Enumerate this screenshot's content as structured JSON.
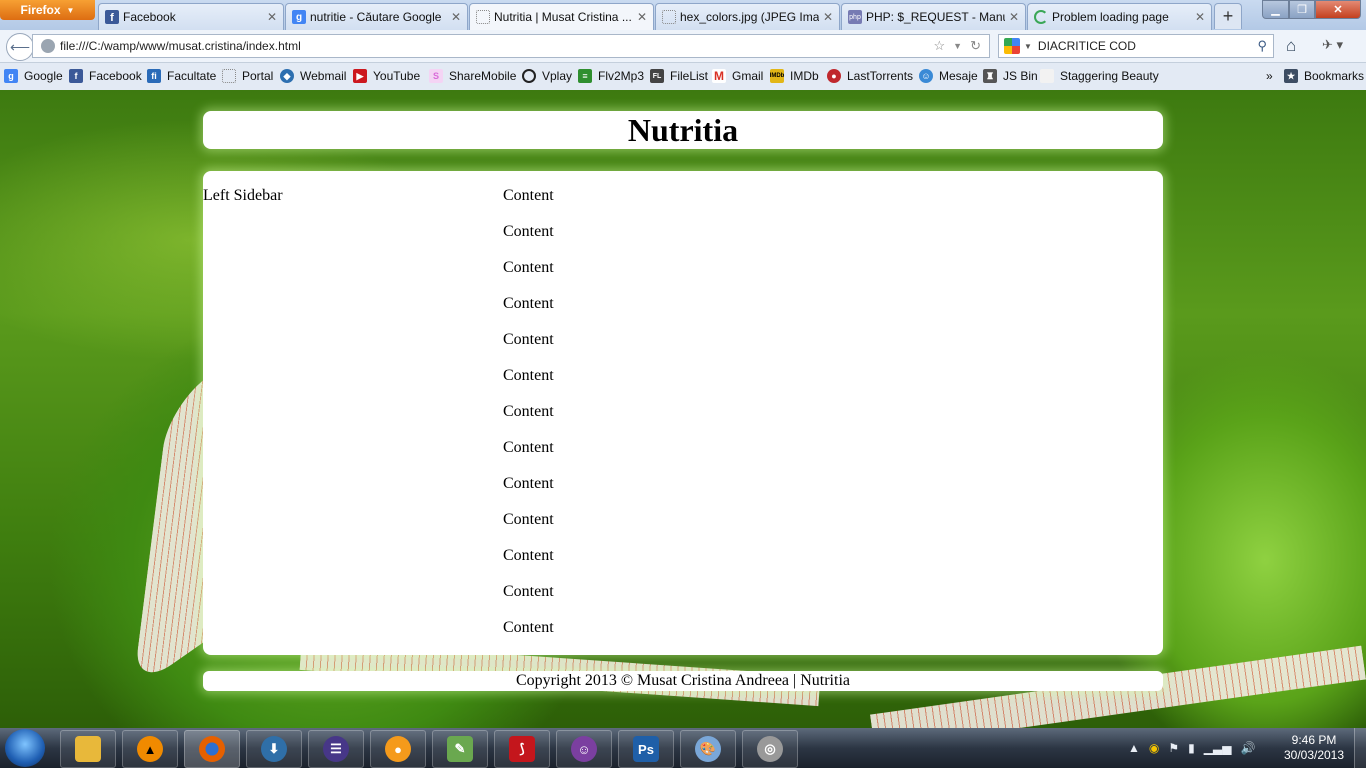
{
  "browser": {
    "menu_button": "Firefox",
    "tabs": [
      {
        "title": "Facebook",
        "icon": "facebook-icon",
        "color": "#3b5998"
      },
      {
        "title": "nutritie - Căutare Google",
        "icon": "google-icon",
        "color": "#4285f4"
      },
      {
        "title": "Nutritia | Musat Cristina ...",
        "icon": "blank-page-icon",
        "color": "#ffffff"
      },
      {
        "title": "hex_colors.jpg (JPEG Ima...",
        "icon": "blank-page-icon",
        "color": "#ffffff"
      },
      {
        "title": "PHP: $_REQUEST - Manual",
        "icon": "php-icon",
        "color": "#777bb3"
      },
      {
        "title": "Problem loading page",
        "icon": "loading-icon",
        "color": "#3aa757"
      }
    ],
    "url": "file:///C:/wamp/www/musat.cristina/index.html",
    "search_value": "DIACRITICE COD",
    "bookmarks": [
      {
        "label": "Google",
        "icon": "google-icon",
        "color": "#4285f4"
      },
      {
        "label": "Facebook",
        "icon": "facebook-icon",
        "color": "#3b5998"
      },
      {
        "label": "Facultate",
        "icon": "facultate-icon",
        "color": "#2a6bb8"
      },
      {
        "label": "Portal",
        "icon": "blank-page-icon",
        "color": "#ffffff"
      },
      {
        "label": "Webmail",
        "icon": "webmail-icon",
        "color": "#2d6fb0"
      },
      {
        "label": "YouTube",
        "icon": "youtube-icon",
        "color": "#cc181e"
      },
      {
        "label": "ShareMobile",
        "icon": "sharemobile-icon",
        "color": "#d96ad9"
      },
      {
        "label": "Vplay",
        "icon": "vplay-icon",
        "color": "#222222"
      },
      {
        "label": "Flv2Mp3",
        "icon": "flv2mp3-icon",
        "color": "#2f8f2f"
      },
      {
        "label": "FileList",
        "icon": "filelist-icon",
        "color": "#444444"
      },
      {
        "label": "Gmail",
        "icon": "gmail-icon",
        "color": "#d93025"
      },
      {
        "label": "IMDb",
        "icon": "imdb-icon",
        "color": "#e2b616"
      },
      {
        "label": "LastTorrents",
        "icon": "lasttorrents-icon",
        "color": "#c0282d"
      },
      {
        "label": "Mesaje",
        "icon": "mesaje-icon",
        "color": "#3a8ad6"
      },
      {
        "label": "JS Bin",
        "icon": "jsbin-icon",
        "color": "#555555"
      },
      {
        "label": "Staggering Beauty",
        "icon": "blank-page-icon",
        "color": "#f2f2f2"
      }
    ],
    "bookmarks_menu": "Bookmarks"
  },
  "page": {
    "title": "Nutritia",
    "sidebar_label": "Left Sidebar",
    "content_items": [
      "Content",
      "Content",
      "Content",
      "Content",
      "Content",
      "Content",
      "Content",
      "Content",
      "Content",
      "Content",
      "Content",
      "Content",
      "Content"
    ],
    "footer": "Copyright 2013 © Musat Cristina Andreea | Nutritia"
  },
  "taskbar": {
    "apps": [
      {
        "name": "explorer",
        "icon": "folder-icon",
        "color": "#e8b83a"
      },
      {
        "name": "vlc",
        "icon": "vlc-icon",
        "color": "#f08a00"
      },
      {
        "name": "firefox",
        "icon": "firefox-icon",
        "color": "#e66000"
      },
      {
        "name": "download-manager",
        "icon": "download-manager-icon",
        "color": "#2f6fa8"
      },
      {
        "name": "eclipse",
        "icon": "eclipse-icon",
        "color": "#473788"
      },
      {
        "name": "media-player",
        "icon": "media-player-icon",
        "color": "#f59a1b"
      },
      {
        "name": "notepad-plus",
        "icon": "notepad-icon",
        "color": "#6aa84f"
      },
      {
        "name": "acrobat",
        "icon": "acrobat-icon",
        "color": "#c4161c"
      },
      {
        "name": "yahoo-messenger",
        "icon": "messenger-icon",
        "color": "#7b3fa0"
      },
      {
        "name": "photoshop",
        "icon": "photoshop-icon",
        "color": "#1f5fa8"
      },
      {
        "name": "paint",
        "icon": "paint-icon",
        "color": "#7aa7d8"
      },
      {
        "name": "audio",
        "icon": "speaker-icon",
        "color": "#999999"
      }
    ],
    "ps_label": "Ps",
    "time": "9:46 PM",
    "date": "30/03/2013"
  }
}
